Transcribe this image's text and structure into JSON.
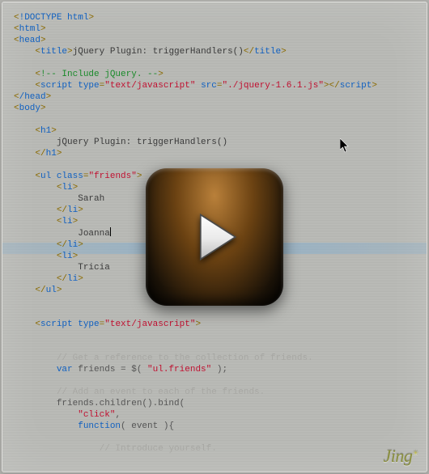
{
  "code": {
    "doctype": "!DOCTYPE html",
    "html_open": "html",
    "head_open": "head",
    "title_tag": "title",
    "title_text": "jQuery Plugin: triggerHandlers()",
    "include_comment": "!-- Include jQuery. --",
    "script_tag": "script",
    "type_attr": "type",
    "type_val": "\"text/javascript\"",
    "src_attr": "src",
    "src_val": "\"./jquery-1.6.1.js\"",
    "head_close": "/head",
    "body_open": "body",
    "h1_tag": "h1",
    "h1_text": "jQuery Plugin: triggerHandlers()",
    "ul_tag": "ul",
    "class_attr": "class",
    "class_val": "\"friends\"",
    "li_tag": "li",
    "friend1": "Sarah",
    "friend2": "Joanna",
    "friend3": "Tricia",
    "js_comment1": "// Get a reference to the collection of friends.",
    "js_var": "var",
    "js_friends_decl": " friends = $( ",
    "js_selector": "\"ul.friends\"",
    "js_friends_end": " );",
    "js_comment2": "// Add an event to each of the friends.",
    "js_bind": "friends.children().bind(",
    "js_click": "\"click\"",
    "js_comma": ",",
    "js_function": "function",
    "js_func_sig": "( event ){",
    "js_comment3": "// Introduce yourself."
  },
  "icons": {
    "play": "play-icon",
    "cursor": "mouse-cursor"
  },
  "branding": {
    "logo": "Jing",
    "sun": "☀"
  }
}
